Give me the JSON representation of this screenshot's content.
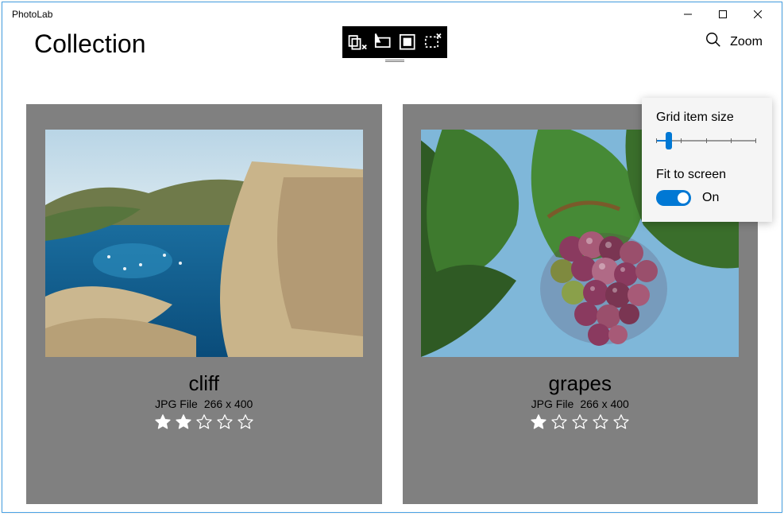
{
  "window": {
    "title": "PhotoLab"
  },
  "header": {
    "page_title": "Collection",
    "zoom_label": "Zoom"
  },
  "toolbar": {
    "buttons": [
      "select-tool",
      "pointer-tool",
      "fill-tool",
      "crop-tool"
    ]
  },
  "flyout": {
    "size_label": "Grid item size",
    "fit_label": "Fit to screen",
    "fit_state": "On"
  },
  "items": [
    {
      "title": "cliff",
      "file_type": "JPG File",
      "dimensions": "266 x 400",
      "rating": 2,
      "image": "coast"
    },
    {
      "title": "grapes",
      "file_type": "JPG File",
      "dimensions": "266 x 400",
      "rating": 1,
      "image": "grapes"
    }
  ]
}
